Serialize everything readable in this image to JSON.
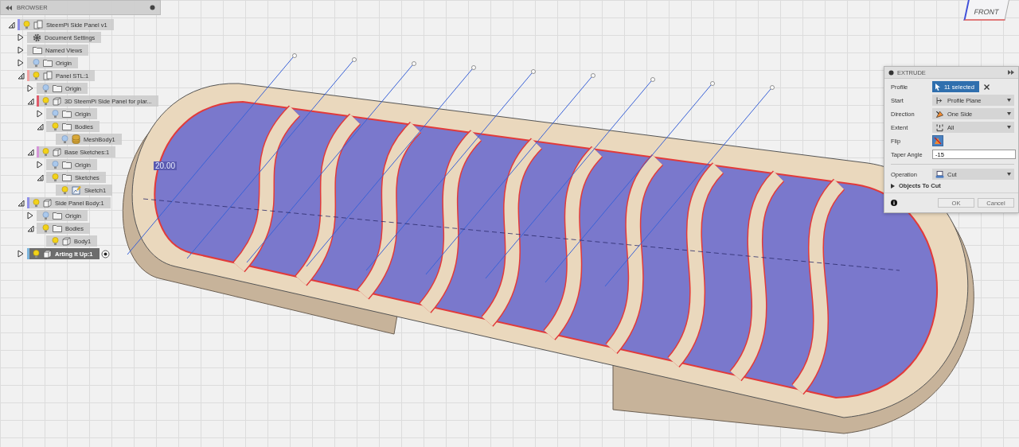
{
  "browser": {
    "title": "BROWSER",
    "tree": [
      {
        "label": "SteemPi Side Panel v1",
        "kind": "component",
        "color": "#8f8fe6",
        "visible": true,
        "expanded": true,
        "selected": false,
        "children": [
          {
            "label": "Document Settings",
            "kind": "gear",
            "expanded": false,
            "selected": false
          },
          {
            "label": "Named Views",
            "kind": "folder",
            "expanded": false,
            "selected": false
          },
          {
            "label": "Origin",
            "kind": "folder",
            "visible": false,
            "expanded": false,
            "selected": false
          },
          {
            "label": "Panel STL:1",
            "kind": "component",
            "color": "#f0a0a0",
            "visible": true,
            "expanded": true,
            "selected": false,
            "children": [
              {
                "label": "Origin",
                "kind": "folder",
                "visible": false,
                "expanded": false,
                "selected": false
              },
              {
                "label": "3D SteemPi Side Panel for plar...",
                "kind": "body",
                "color": "#e05a6a",
                "visible": true,
                "expanded": true,
                "selected": false,
                "children": [
                  {
                    "label": "Origin",
                    "kind": "folder",
                    "visible": false,
                    "expanded": false,
                    "selected": false
                  },
                  {
                    "label": "Bodies",
                    "kind": "folder",
                    "visible": true,
                    "expanded": true,
                    "selected": false,
                    "children": [
                      {
                        "label": "MeshBody1",
                        "kind": "mesh",
                        "visible": false,
                        "selected": false
                      }
                    ]
                  }
                ]
              },
              {
                "label": "Base Sketches:1",
                "kind": "body",
                "color": "#d596d8",
                "visible": true,
                "expanded": true,
                "selected": false,
                "children": [
                  {
                    "label": "Origin",
                    "kind": "folder",
                    "visible": false,
                    "expanded": false,
                    "selected": false
                  },
                  {
                    "label": "Sketches",
                    "kind": "folder",
                    "visible": true,
                    "expanded": true,
                    "selected": false,
                    "children": [
                      {
                        "label": "Sketch1",
                        "kind": "sketch",
                        "visible": true,
                        "selected": false
                      }
                    ]
                  }
                ]
              }
            ]
          },
          {
            "label": "Side Panel Body:1",
            "kind": "body",
            "color": "#9090e8",
            "visible": true,
            "expanded": true,
            "selected": false,
            "children": [
              {
                "label": "Origin",
                "kind": "folder",
                "visible": false,
                "expanded": false,
                "selected": false
              },
              {
                "label": "Bodies",
                "kind": "folder",
                "visible": true,
                "expanded": true,
                "selected": false,
                "children": [
                  {
                    "label": "Body1",
                    "kind": "body",
                    "visible": true,
                    "selected": false
                  }
                ]
              }
            ]
          },
          {
            "label": "Arting It Up:1",
            "kind": "body",
            "color": "#7ab4dc",
            "visible": true,
            "expanded": false,
            "selected": true,
            "active": true
          }
        ]
      }
    ]
  },
  "viewport": {
    "dimension": "20.00",
    "view_cube": "FRONT"
  },
  "extrude": {
    "title": "EXTRUDE",
    "rows": [
      {
        "label": "Profile",
        "kind": "selection",
        "value": "11 selected"
      },
      {
        "label": "Start",
        "kind": "dropdown",
        "value": "Profile Plane"
      },
      {
        "label": "Direction",
        "kind": "dropdown",
        "value": "One Side"
      },
      {
        "label": "Extent",
        "kind": "dropdown",
        "value": "All"
      },
      {
        "label": "Flip",
        "kind": "toggle",
        "on": true
      },
      {
        "label": "Taper Angle",
        "kind": "number",
        "value": "-15"
      }
    ],
    "operation": {
      "label": "Operation",
      "value": "Cut"
    },
    "section": {
      "label": "Objects To Cut",
      "expanded": false
    },
    "buttons": [
      "OK",
      "Cancel"
    ]
  }
}
